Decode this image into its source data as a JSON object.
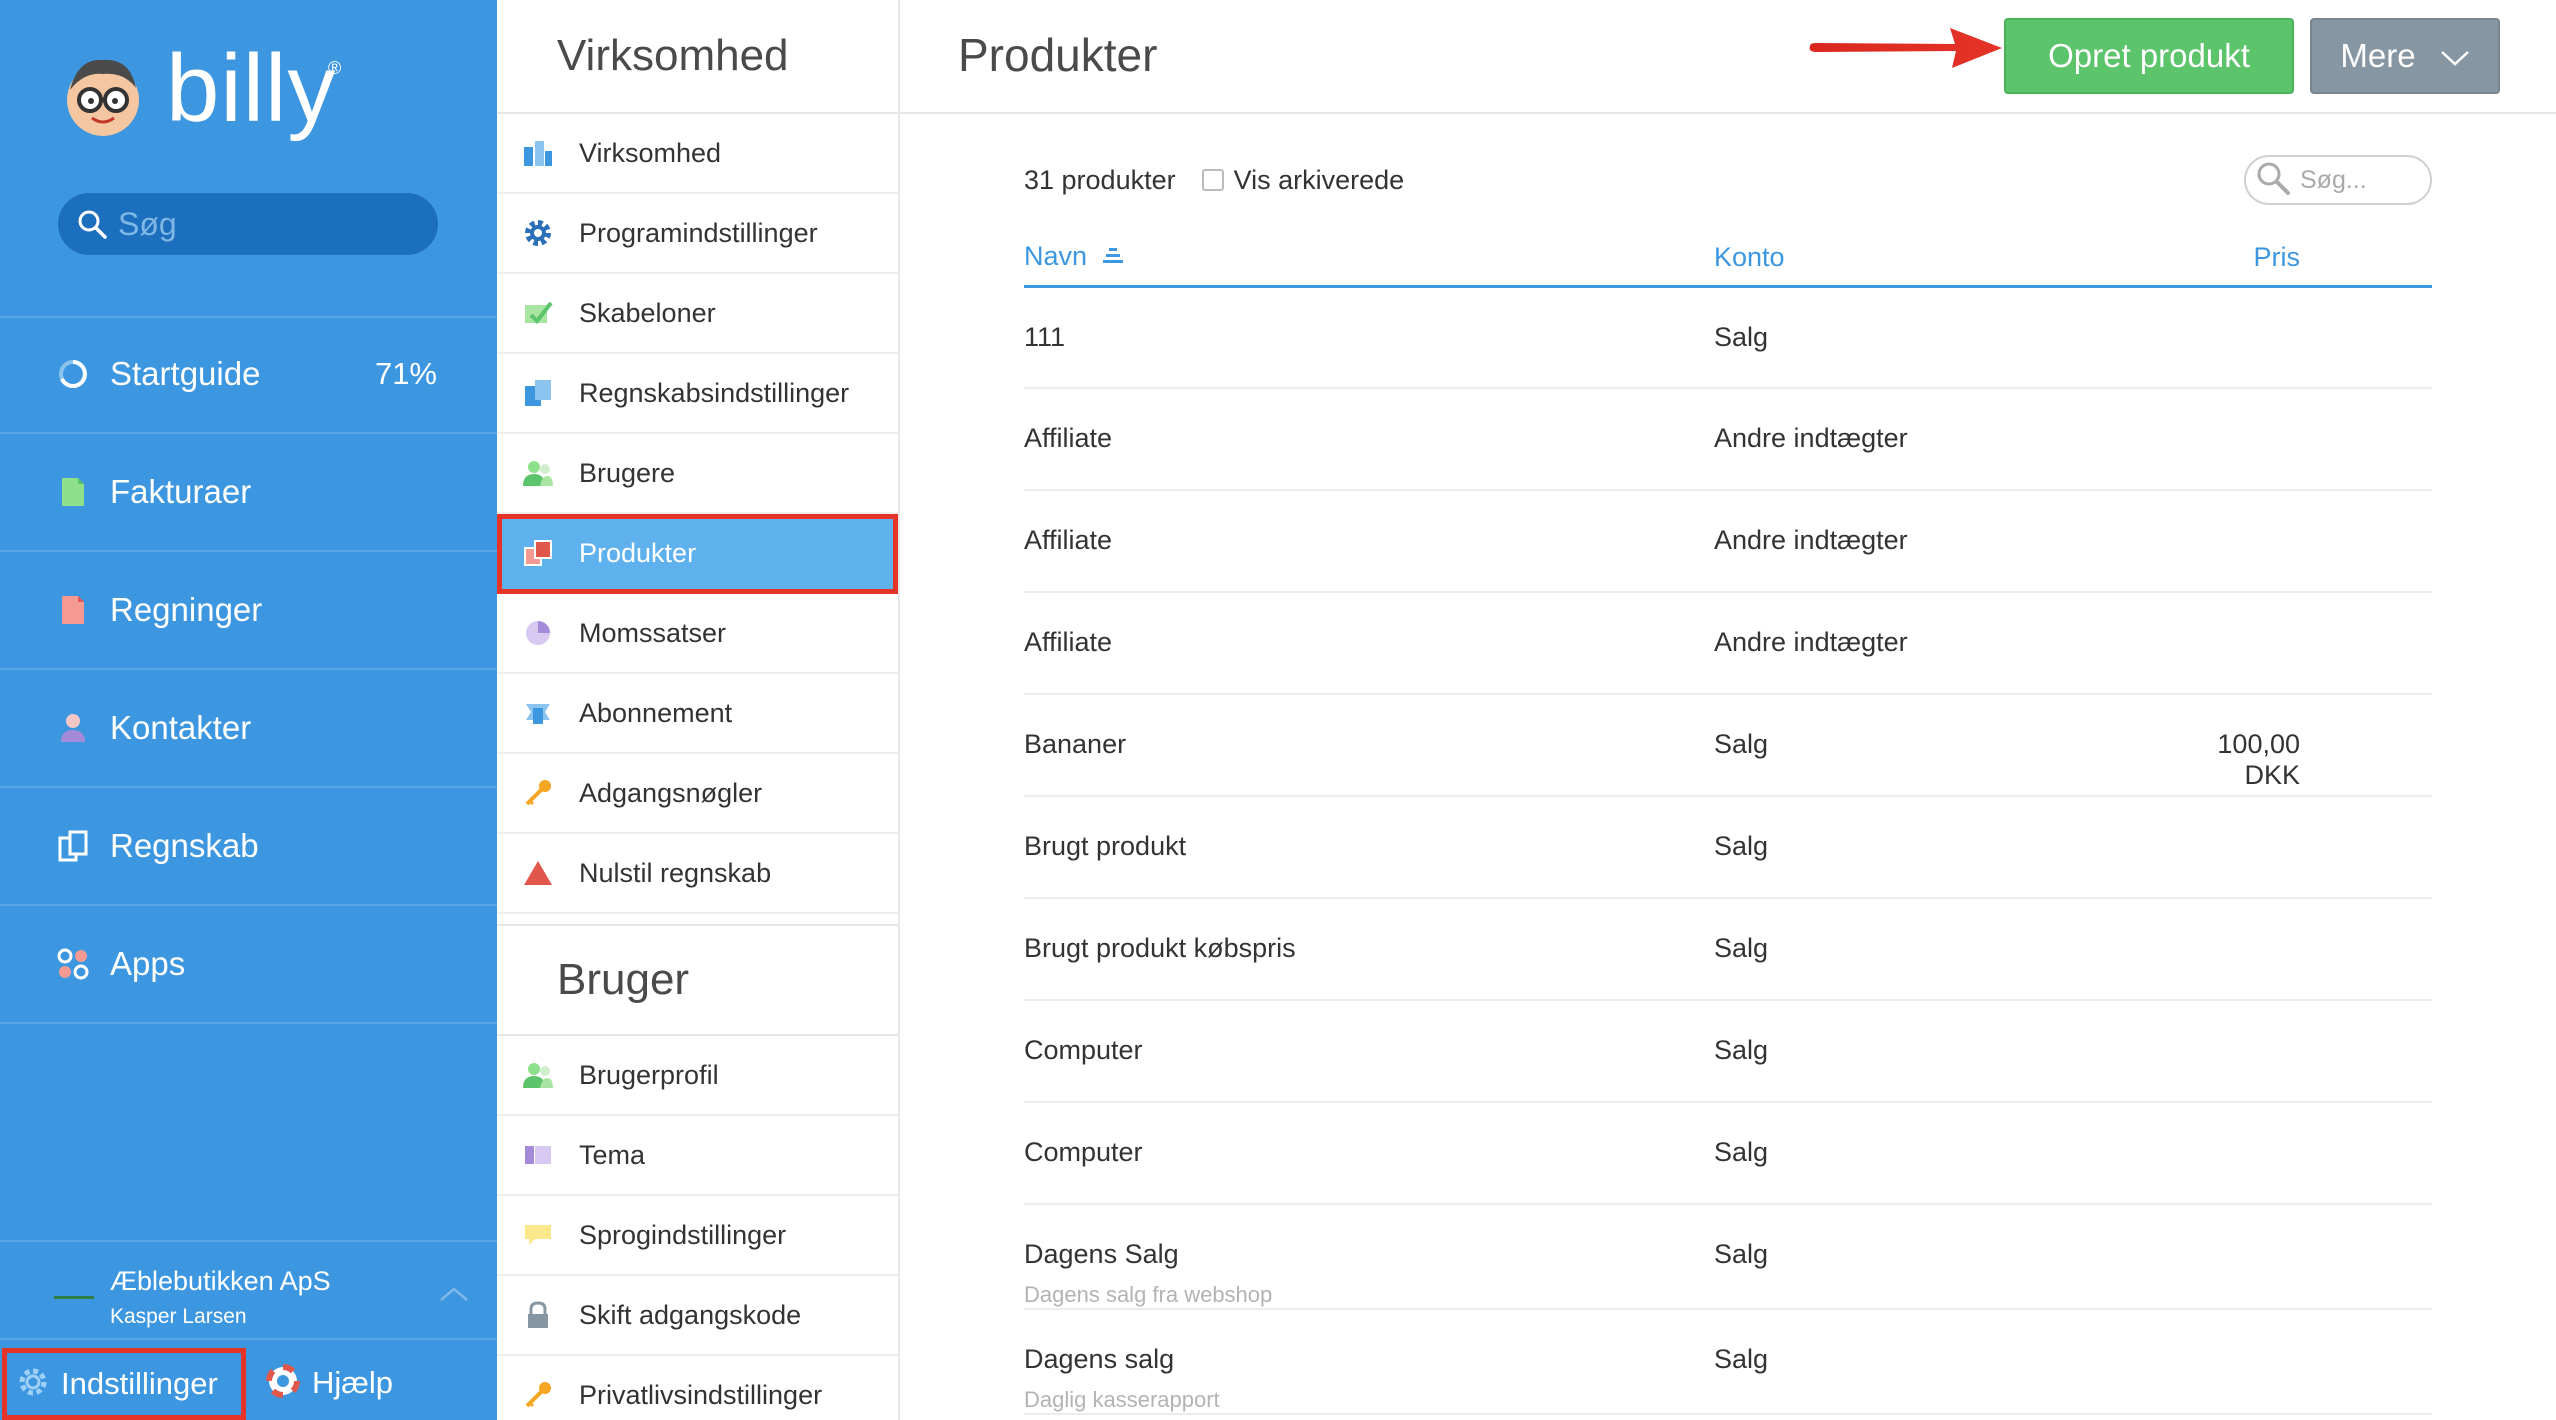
{
  "app": {
    "name": "billy",
    "registered": "®"
  },
  "sidebar": {
    "search_placeholder": "Søg",
    "items": [
      {
        "label": "Startguide",
        "value": "71%",
        "icon": "progress-ring-icon"
      },
      {
        "label": "Fakturaer",
        "icon": "invoice-icon"
      },
      {
        "label": "Regninger",
        "icon": "bill-icon"
      },
      {
        "label": "Kontakter",
        "icon": "contact-icon"
      },
      {
        "label": "Regnskab",
        "icon": "ledger-icon"
      },
      {
        "label": "Apps",
        "icon": "apps-icon"
      }
    ],
    "company": {
      "name": "Æblebutikken ApS",
      "user": "Kasper Larsen"
    },
    "settings_label": "Indstillinger",
    "help_label": "Hjælp"
  },
  "settings_nav": {
    "company_heading": "Virksomhed",
    "company_items": [
      {
        "label": "Virksomhed",
        "icon": "building-icon"
      },
      {
        "label": "Programindstillinger",
        "icon": "gear-icon"
      },
      {
        "label": "Skabeloner",
        "icon": "template-icon"
      },
      {
        "label": "Regnskabsindstillinger",
        "icon": "accounting-icon"
      },
      {
        "label": "Brugere",
        "icon": "users-icon"
      },
      {
        "label": "Produkter",
        "icon": "products-icon",
        "active": true
      },
      {
        "label": "Momssatser",
        "icon": "pie-icon"
      },
      {
        "label": "Abonnement",
        "icon": "subscription-icon"
      },
      {
        "label": "Adgangsnøgler",
        "icon": "key-icon"
      },
      {
        "label": "Nulstil regnskab",
        "icon": "warning-icon"
      }
    ],
    "user_heading": "Bruger",
    "user_items": [
      {
        "label": "Brugerprofil",
        "icon": "user-icon"
      },
      {
        "label": "Tema",
        "icon": "theme-icon"
      },
      {
        "label": "Sprogindstillinger",
        "icon": "speech-icon"
      },
      {
        "label": "Skift adgangskode",
        "icon": "lock-icon"
      },
      {
        "label": "Privatlivsindstillinger",
        "icon": "key-icon"
      }
    ]
  },
  "main": {
    "title": "Produkter",
    "create_button": "Opret produkt",
    "more_button": "Mere",
    "count_label": "31 produkter",
    "show_archived_label": "Vis arkiverede",
    "search_placeholder": "Søg...",
    "columns": {
      "name": "Navn",
      "account": "Konto",
      "price": "Pris"
    },
    "rows": [
      {
        "name": "111",
        "account": "Salg",
        "price": "",
        "sub": ""
      },
      {
        "name": "Affiliate",
        "account": "Andre indtægter",
        "price": "",
        "sub": ""
      },
      {
        "name": "Affiliate",
        "account": "Andre indtægter",
        "price": "",
        "sub": ""
      },
      {
        "name": "Affiliate",
        "account": "Andre indtægter",
        "price": "",
        "sub": ""
      },
      {
        "name": "Bananer",
        "account": "Salg",
        "price": "100,00 DKK",
        "sub": ""
      },
      {
        "name": "Brugt produkt",
        "account": "Salg",
        "price": "",
        "sub": ""
      },
      {
        "name": "Brugt produkt købspris",
        "account": "Salg",
        "price": "",
        "sub": ""
      },
      {
        "name": "Computer",
        "account": "Salg",
        "price": "",
        "sub": ""
      },
      {
        "name": "Computer",
        "account": "Salg",
        "price": "",
        "sub": ""
      },
      {
        "name": "Dagens Salg",
        "account": "Salg",
        "price": "",
        "sub": "Dagens salg fra webshop"
      },
      {
        "name": "Dagens salg",
        "account": "Salg",
        "price": "",
        "sub": "Daglig kasserapport"
      }
    ]
  },
  "colors": {
    "sidebar": "#3d97e0",
    "accent": "#3d97e0",
    "create": "#5cc46a",
    "more": "#8696a2",
    "highlight": "#e53328"
  }
}
